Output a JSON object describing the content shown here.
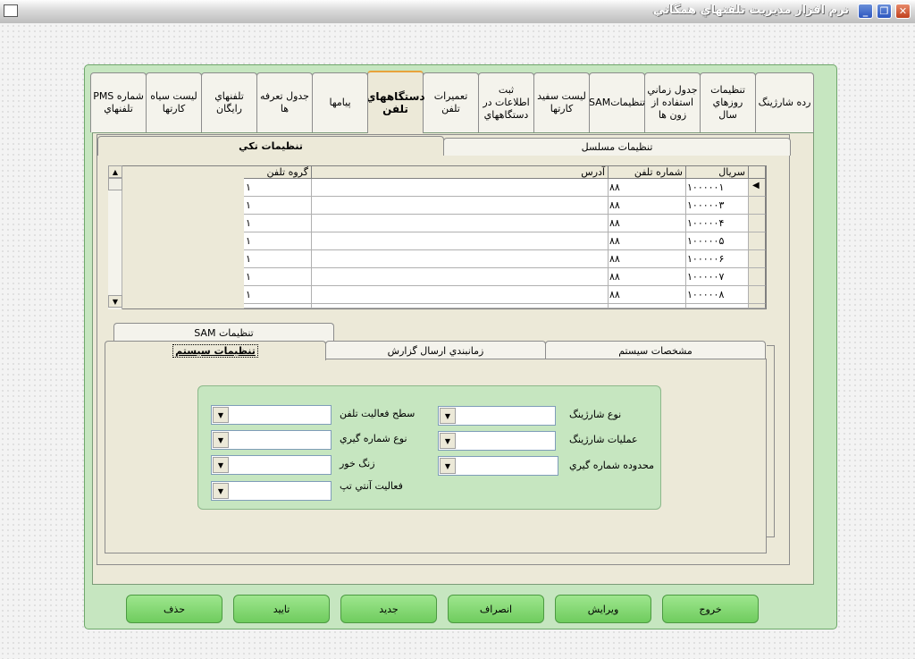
{
  "window": {
    "title": "نرم افزار مديريت تلفنهاي همگاني"
  },
  "top_tabs": [
    {
      "label": "رده شارژينگ"
    },
    {
      "label": "تنظيمات روزهاي سال"
    },
    {
      "label": "جدول زماني استفاده از زون ها"
    },
    {
      "label": "تنظيماتSAM"
    },
    {
      "label": "ليست سفيد كارتها"
    },
    {
      "label": "ثبت اطلاعات در دستگاههاي"
    },
    {
      "label": "تعميرات تلفن"
    },
    {
      "label": "دستگاههاي تلفن"
    },
    {
      "label": "پيامها"
    },
    {
      "label": "جدول تعرفه ها"
    },
    {
      "label": "تلفنهاي رايگان"
    },
    {
      "label": "ليست سياه كارتها"
    },
    {
      "label": "شماره PMS تلفنهاي"
    }
  ],
  "sub_tabs": {
    "serial": "تنظيمات مسلسل",
    "single": "تنظيمات تكي"
  },
  "grid": {
    "headers": {
      "serial": "سريال",
      "phone": "شماره تلفن",
      "address": "آدرس",
      "group": "گروه تلفن"
    },
    "rows": [
      {
        "serial": "۱۰۰۰۰۰۱",
        "phone": "۸۸",
        "address": "",
        "group": "۱"
      },
      {
        "serial": "۱۰۰۰۰۰۳",
        "phone": "۸۸",
        "address": "",
        "group": "۱"
      },
      {
        "serial": "۱۰۰۰۰۰۴",
        "phone": "۸۸",
        "address": "",
        "group": "۱"
      },
      {
        "serial": "۱۰۰۰۰۰۵",
        "phone": "۸۸",
        "address": "",
        "group": "۱"
      },
      {
        "serial": "۱۰۰۰۰۰۶",
        "phone": "۸۸",
        "address": "",
        "group": "۱"
      },
      {
        "serial": "۱۰۰۰۰۰۷",
        "phone": "۸۸",
        "address": "",
        "group": "۱"
      },
      {
        "serial": "۱۰۰۰۰۰۸",
        "phone": "۸۸",
        "address": "",
        "group": "۱"
      }
    ]
  },
  "lower_tabs": {
    "sam": "تنظيمات SAM",
    "system_settings": "تنظيمات سيستم",
    "report_schedule": "زمانبندي ارسال گزارش",
    "system_specs": "مشخصات سيستم"
  },
  "settings": {
    "charging_type": "نوع شارژينگ",
    "charging_ops": "عمليات شارژينگ",
    "dialing_range": "محدوده شماره گيري",
    "activity_level": "سطح فعاليت تلفن",
    "dialing_type": "نوع شماره گيري",
    "ring": "زنگ خور",
    "antitap": "فعاليت آنتي تپ"
  },
  "buttons": {
    "exit": "خروج",
    "edit": "ويرايش",
    "cancel": "انصراف",
    "new": "جديد",
    "confirm": "تاييد",
    "delete": "حذف"
  }
}
